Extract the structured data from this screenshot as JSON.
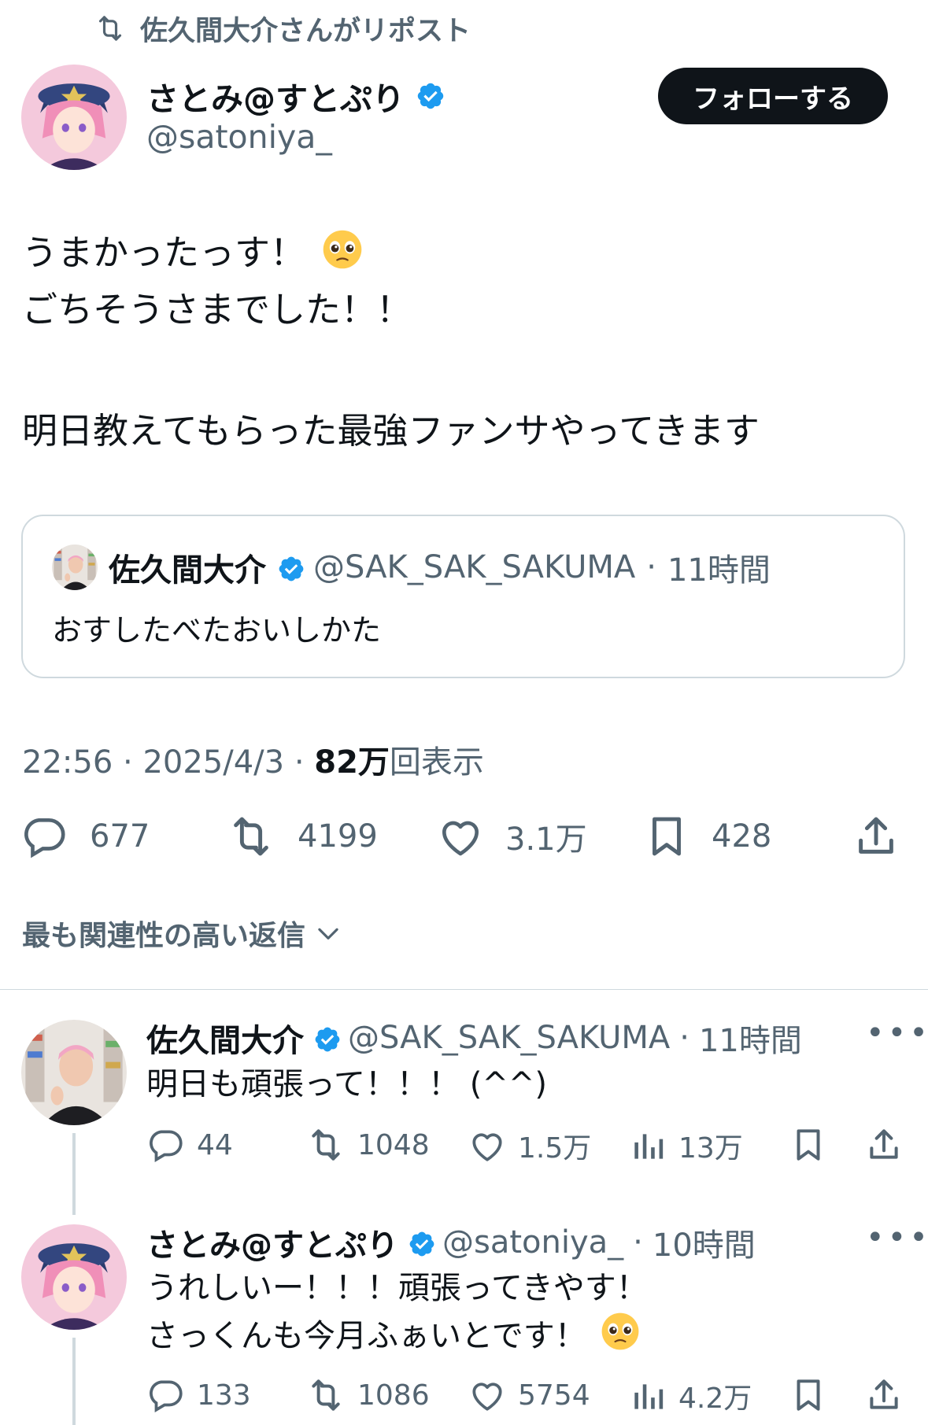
{
  "repost_banner": {
    "text": "佐久間大介さんがリポスト",
    "icon": "repost-icon"
  },
  "main_post": {
    "author_name": "さとみ@すとぷり",
    "author_handle": "@satoniya_",
    "follow_label": "フォローする",
    "body_lines": [
      "うまかったっす！",
      "ごちそうさまでした！！",
      "明日教えてもらった最強ファンサやってきます"
    ],
    "body_emoji": "🥺",
    "quote": {
      "author_name": "佐久間大介",
      "author_handle": "@SAK_SAK_SAKUMA",
      "time": "11時間",
      "text": "おすしたべたおいしかた"
    },
    "meta": {
      "time": "22:56",
      "date": "2025/4/3",
      "views_count": "82万",
      "views_label": "回表示"
    },
    "stats": {
      "replies": "677",
      "reposts": "4199",
      "likes": "3.1万",
      "bookmarks": "428"
    }
  },
  "sort_label": "最も関連性の高い返信",
  "replies": [
    {
      "author_name": "佐久間大介",
      "author_handle": "@SAK_SAK_SAKUMA",
      "time": "11時間",
      "lines": [
        "明日も頑張って！！！ (^^)"
      ],
      "stats": {
        "replies": "44",
        "reposts": "1048",
        "likes": "1.5万",
        "views": "13万"
      }
    },
    {
      "author_name": "さとみ@すとぷり",
      "author_handle": "@satoniya_",
      "time": "10時間",
      "lines": [
        "うれしいー！！！頑張ってきやす！",
        "さっくんも今月ふぁいとです！"
      ],
      "emoji": "🥺",
      "stats": {
        "replies": "133",
        "reposts": "1086",
        "likes": "5754",
        "views": "4.2万"
      }
    }
  ],
  "colors": {
    "text": "#0f1419",
    "secondary": "#536471",
    "verified": "#1d9bf0",
    "border": "#cfd9de"
  }
}
